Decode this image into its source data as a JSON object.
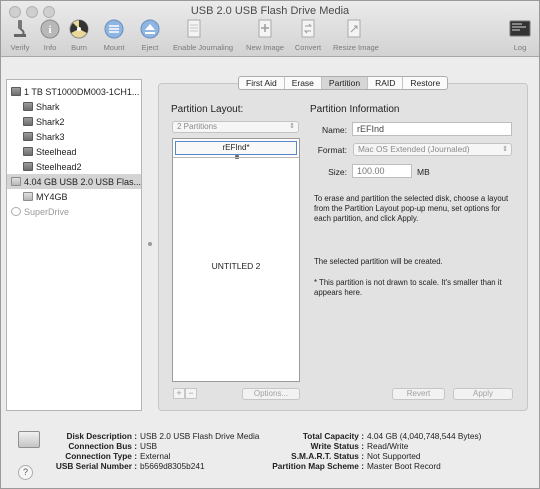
{
  "window": {
    "title": "USB 2.0 USB Flash Drive Media"
  },
  "toolbar": {
    "items": [
      {
        "label": "Verify",
        "icon": "microscope-icon"
      },
      {
        "label": "Info",
        "icon": "info-icon"
      },
      {
        "label": "Burn",
        "icon": "burn-icon"
      },
      {
        "label": "Mount",
        "icon": "mount-icon"
      },
      {
        "label": "Eject",
        "icon": "eject-icon"
      },
      {
        "label": "Enable Journaling",
        "icon": "journal-icon"
      },
      {
        "label": "New Image",
        "icon": "new-image-icon"
      },
      {
        "label": "Convert",
        "icon": "convert-icon"
      },
      {
        "label": "Resize Image",
        "icon": "resize-image-icon"
      },
      {
        "label": "Log",
        "icon": "log-icon"
      }
    ]
  },
  "sidebar": {
    "items": [
      {
        "label": "1 TB ST1000DM003-1CH1...",
        "indent": 0,
        "kind": "disk",
        "selected": false
      },
      {
        "label": "Shark",
        "indent": 1,
        "kind": "volume",
        "selected": false
      },
      {
        "label": "Shark2",
        "indent": 1,
        "kind": "volume",
        "selected": false
      },
      {
        "label": "Shark3",
        "indent": 1,
        "kind": "volume",
        "selected": false
      },
      {
        "label": "Steelhead",
        "indent": 1,
        "kind": "volume",
        "selected": false
      },
      {
        "label": "Steelhead2",
        "indent": 1,
        "kind": "volume",
        "selected": false
      },
      {
        "label": "4.04 GB USB 2.0 USB Flas...",
        "indent": 0,
        "kind": "usb",
        "selected": true
      },
      {
        "label": "MY4GB",
        "indent": 1,
        "kind": "usb-volume",
        "selected": false
      },
      {
        "label": "SuperDrive",
        "indent": 0,
        "kind": "optical",
        "selected": false
      }
    ]
  },
  "tabs": [
    {
      "label": "First Aid",
      "active": false
    },
    {
      "label": "Erase",
      "active": false
    },
    {
      "label": "Partition",
      "active": true
    },
    {
      "label": "RAID",
      "active": false
    },
    {
      "label": "Restore",
      "active": false
    }
  ],
  "partition_layout": {
    "title": "Partition Layout:",
    "scheme_value": "2 Partitions",
    "partitions": [
      {
        "name": "rEFInd*"
      },
      {
        "name": "UNTITLED 2"
      }
    ],
    "add_label": "+",
    "remove_label": "−",
    "options_label": "Options..."
  },
  "partition_info": {
    "title": "Partition Information",
    "name_label": "Name:",
    "name_value": "rEFInd",
    "format_label": "Format:",
    "format_value": "Mac OS Extended (Journaled)",
    "size_label": "Size:",
    "size_value": "100.00",
    "size_unit": "MB",
    "description": "To erase and partition the selected disk, choose a layout from the Partition Layout pop-up menu, set options for each partition, and click Apply.",
    "status": "The selected partition will be created.",
    "note": "* This partition is not drawn to scale. It's smaller than it appears here.",
    "revert_label": "Revert",
    "apply_label": "Apply"
  },
  "details": {
    "left": [
      {
        "key": "Disk Description :",
        "value": "USB 2.0 USB Flash Drive Media"
      },
      {
        "key": "Connection Bus :",
        "value": "USB"
      },
      {
        "key": "Connection Type :",
        "value": "External"
      },
      {
        "key": "USB Serial Number :",
        "value": "b5669d8305b241"
      }
    ],
    "right": [
      {
        "key": "Total Capacity :",
        "value": "4.04 GB (4,040,748,544 Bytes)"
      },
      {
        "key": "Write Status :",
        "value": "Read/Write"
      },
      {
        "key": "S.M.A.R.T. Status :",
        "value": "Not Supported"
      },
      {
        "key": "Partition Map Scheme :",
        "value": "Master Boot Record"
      }
    ],
    "help_label": "?"
  }
}
